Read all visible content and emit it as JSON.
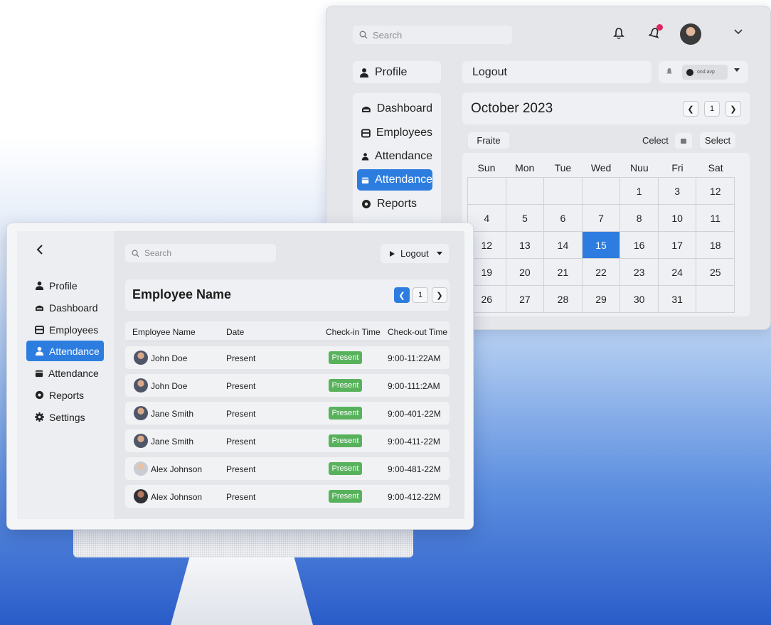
{
  "back_panel": {
    "search": {
      "placeholder": "Search"
    },
    "profile_label": "Profile",
    "sidebar": {
      "items": [
        {
          "label": "Dashboard",
          "icon": "dashboard-icon",
          "active": false
        },
        {
          "label": "Employees",
          "icon": "employees-icon",
          "active": false
        },
        {
          "label": "Attendance",
          "icon": "user-icon",
          "active": false
        },
        {
          "label": "Attendance",
          "icon": "calendar-icon",
          "active": true
        },
        {
          "label": "Reports",
          "icon": "reports-icon",
          "active": false
        }
      ]
    },
    "logout_label": "Logout",
    "user_chip": "ond.avp",
    "calendar": {
      "title": "October 2023",
      "page": "1",
      "fraite_label": "Fraite",
      "celect_label": "Celect",
      "select_label": "Select",
      "weekdays": [
        "Sun",
        "Mon",
        "Tue",
        "Wed",
        "Nuu",
        "Fri",
        "Sat"
      ],
      "weeks": [
        [
          "",
          "",
          "",
          "",
          "1",
          "3",
          "12"
        ],
        [
          "4",
          "5",
          "6",
          "7",
          "8",
          "10",
          "11"
        ],
        [
          "12",
          "13",
          "14",
          "15",
          "16",
          "17",
          "18"
        ],
        [
          "19",
          "20",
          "21",
          "22",
          "23",
          "24",
          "25"
        ],
        [
          "26",
          "27",
          "28",
          "29",
          "30",
          "31",
          ""
        ]
      ],
      "selected_day": "15"
    }
  },
  "front_panel": {
    "back_label": "<",
    "sidebar": {
      "items": [
        {
          "label": "Profile",
          "icon": "user-icon",
          "active": false
        },
        {
          "label": "Dashboard",
          "icon": "dashboard-icon",
          "active": false
        },
        {
          "label": "Employees",
          "icon": "employees-icon",
          "active": false
        },
        {
          "label": "Attendance",
          "icon": "user-icon",
          "active": true
        },
        {
          "label": "Attendance",
          "icon": "calendar-icon",
          "active": false
        },
        {
          "label": "Reports",
          "icon": "reports-icon",
          "active": false
        },
        {
          "label": "Settings",
          "icon": "gear-icon",
          "active": false
        }
      ]
    },
    "search": {
      "placeholder": "Search"
    },
    "logout_label": "Logout",
    "title": "Employee Name",
    "page": "1",
    "table": {
      "columns": [
        "Employee Name",
        "Date",
        "Check-in Time",
        "Check-out Time"
      ],
      "rows": [
        {
          "name": "John Doe",
          "date": "Present",
          "status": "Present",
          "checkout": "9:00-11:22AM"
        },
        {
          "name": "John Doe",
          "date": "Present",
          "status": "Present",
          "checkout": "9:00-111:2AM"
        },
        {
          "name": "Jane Smith",
          "date": "Present",
          "status": "Present",
          "checkout": "9:00-401-22M"
        },
        {
          "name": "Jane Smith",
          "date": "Present",
          "status": "Present",
          "checkout": "9:00-411-22M"
        },
        {
          "name": "Alex Johnson",
          "date": "Present",
          "status": "Present",
          "checkout": "9:00-481-22M"
        },
        {
          "name": "Alex Johnson",
          "date": "Present",
          "status": "Present",
          "checkout": "9:00-412-22M"
        }
      ]
    }
  },
  "colors": {
    "accent": "#2d7de0",
    "status_present": "#58b25c",
    "notification": "#e0245e"
  }
}
